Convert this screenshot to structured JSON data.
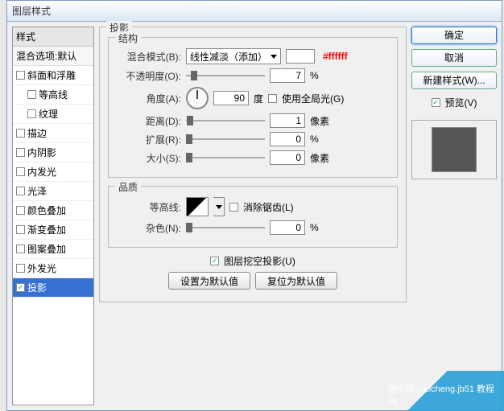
{
  "title": "图层样式",
  "left": {
    "header": "样式",
    "sub": "混合选项:默认",
    "items": [
      {
        "label": "斜面和浮雕",
        "checked": false,
        "level": 1
      },
      {
        "label": "等高线",
        "checked": false,
        "level": 2
      },
      {
        "label": "纹理",
        "checked": false,
        "level": 2
      },
      {
        "label": "描边",
        "checked": false,
        "level": 1
      },
      {
        "label": "内阴影",
        "checked": false,
        "level": 1
      },
      {
        "label": "内发光",
        "checked": false,
        "level": 1
      },
      {
        "label": "光泽",
        "checked": false,
        "level": 1
      },
      {
        "label": "颜色叠加",
        "checked": false,
        "level": 1
      },
      {
        "label": "渐变叠加",
        "checked": false,
        "level": 1
      },
      {
        "label": "图案叠加",
        "checked": false,
        "level": 1
      },
      {
        "label": "外发光",
        "checked": false,
        "level": 1
      },
      {
        "label": "投影",
        "checked": true,
        "level": 1,
        "selected": true
      }
    ]
  },
  "main": {
    "group_title": "投影",
    "structure_title": "结构",
    "blend_label": "混合模式(B):",
    "blend_value": "线性减淡（添加）",
    "color_hex": "#ffffff",
    "opacity_label": "不透明度(O):",
    "opacity_value": "7",
    "percent": "%",
    "angle_label": "角度(A):",
    "angle_value": "90",
    "angle_unit": "度",
    "global_light": "使用全局光(G)",
    "distance_label": "距离(D):",
    "distance_value": "1",
    "px": "像素",
    "spread_label": "扩展(R):",
    "spread_value": "0",
    "size_label": "大小(S):",
    "size_value": "0",
    "quality_title": "品质",
    "contour_label": "等高线:",
    "antialias": "消除锯齿(L)",
    "noise_label": "杂色(N):",
    "noise_value": "0",
    "knockout": "图层挖空投影(U)",
    "btn_default": "设置为默认值",
    "btn_reset": "复位为默认值"
  },
  "right": {
    "ok": "确定",
    "cancel": "取消",
    "newstyle": "新建样式(W)...",
    "preview": "预览(V)"
  },
  "watermark": "趣宇典 jiaocheng.jb51 教程 网"
}
